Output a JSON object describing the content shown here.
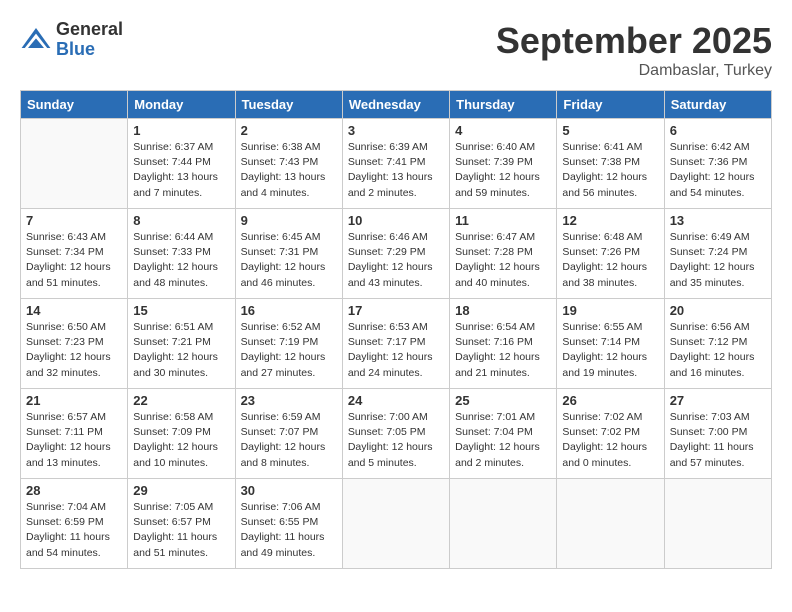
{
  "header": {
    "logo_general": "General",
    "logo_blue": "Blue",
    "month_title": "September 2025",
    "location": "Dambaslar, Turkey"
  },
  "days_of_week": [
    "Sunday",
    "Monday",
    "Tuesday",
    "Wednesday",
    "Thursday",
    "Friday",
    "Saturday"
  ],
  "weeks": [
    [
      {
        "day": "",
        "sunrise": "",
        "sunset": "",
        "daylight": ""
      },
      {
        "day": "1",
        "sunrise": "6:37 AM",
        "sunset": "7:44 PM",
        "daylight": "13 hours and 7 minutes."
      },
      {
        "day": "2",
        "sunrise": "6:38 AM",
        "sunset": "7:43 PM",
        "daylight": "13 hours and 4 minutes."
      },
      {
        "day": "3",
        "sunrise": "6:39 AM",
        "sunset": "7:41 PM",
        "daylight": "13 hours and 2 minutes."
      },
      {
        "day": "4",
        "sunrise": "6:40 AM",
        "sunset": "7:39 PM",
        "daylight": "12 hours and 59 minutes."
      },
      {
        "day": "5",
        "sunrise": "6:41 AM",
        "sunset": "7:38 PM",
        "daylight": "12 hours and 56 minutes."
      },
      {
        "day": "6",
        "sunrise": "6:42 AM",
        "sunset": "7:36 PM",
        "daylight": "12 hours and 54 minutes."
      }
    ],
    [
      {
        "day": "7",
        "sunrise": "6:43 AM",
        "sunset": "7:34 PM",
        "daylight": "12 hours and 51 minutes."
      },
      {
        "day": "8",
        "sunrise": "6:44 AM",
        "sunset": "7:33 PM",
        "daylight": "12 hours and 48 minutes."
      },
      {
        "day": "9",
        "sunrise": "6:45 AM",
        "sunset": "7:31 PM",
        "daylight": "12 hours and 46 minutes."
      },
      {
        "day": "10",
        "sunrise": "6:46 AM",
        "sunset": "7:29 PM",
        "daylight": "12 hours and 43 minutes."
      },
      {
        "day": "11",
        "sunrise": "6:47 AM",
        "sunset": "7:28 PM",
        "daylight": "12 hours and 40 minutes."
      },
      {
        "day": "12",
        "sunrise": "6:48 AM",
        "sunset": "7:26 PM",
        "daylight": "12 hours and 38 minutes."
      },
      {
        "day": "13",
        "sunrise": "6:49 AM",
        "sunset": "7:24 PM",
        "daylight": "12 hours and 35 minutes."
      }
    ],
    [
      {
        "day": "14",
        "sunrise": "6:50 AM",
        "sunset": "7:23 PM",
        "daylight": "12 hours and 32 minutes."
      },
      {
        "day": "15",
        "sunrise": "6:51 AM",
        "sunset": "7:21 PM",
        "daylight": "12 hours and 30 minutes."
      },
      {
        "day": "16",
        "sunrise": "6:52 AM",
        "sunset": "7:19 PM",
        "daylight": "12 hours and 27 minutes."
      },
      {
        "day": "17",
        "sunrise": "6:53 AM",
        "sunset": "7:17 PM",
        "daylight": "12 hours and 24 minutes."
      },
      {
        "day": "18",
        "sunrise": "6:54 AM",
        "sunset": "7:16 PM",
        "daylight": "12 hours and 21 minutes."
      },
      {
        "day": "19",
        "sunrise": "6:55 AM",
        "sunset": "7:14 PM",
        "daylight": "12 hours and 19 minutes."
      },
      {
        "day": "20",
        "sunrise": "6:56 AM",
        "sunset": "7:12 PM",
        "daylight": "12 hours and 16 minutes."
      }
    ],
    [
      {
        "day": "21",
        "sunrise": "6:57 AM",
        "sunset": "7:11 PM",
        "daylight": "12 hours and 13 minutes."
      },
      {
        "day": "22",
        "sunrise": "6:58 AM",
        "sunset": "7:09 PM",
        "daylight": "12 hours and 10 minutes."
      },
      {
        "day": "23",
        "sunrise": "6:59 AM",
        "sunset": "7:07 PM",
        "daylight": "12 hours and 8 minutes."
      },
      {
        "day": "24",
        "sunrise": "7:00 AM",
        "sunset": "7:05 PM",
        "daylight": "12 hours and 5 minutes."
      },
      {
        "day": "25",
        "sunrise": "7:01 AM",
        "sunset": "7:04 PM",
        "daylight": "12 hours and 2 minutes."
      },
      {
        "day": "26",
        "sunrise": "7:02 AM",
        "sunset": "7:02 PM",
        "daylight": "12 hours and 0 minutes."
      },
      {
        "day": "27",
        "sunrise": "7:03 AM",
        "sunset": "7:00 PM",
        "daylight": "11 hours and 57 minutes."
      }
    ],
    [
      {
        "day": "28",
        "sunrise": "7:04 AM",
        "sunset": "6:59 PM",
        "daylight": "11 hours and 54 minutes."
      },
      {
        "day": "29",
        "sunrise": "7:05 AM",
        "sunset": "6:57 PM",
        "daylight": "11 hours and 51 minutes."
      },
      {
        "day": "30",
        "sunrise": "7:06 AM",
        "sunset": "6:55 PM",
        "daylight": "11 hours and 49 minutes."
      },
      {
        "day": "",
        "sunrise": "",
        "sunset": "",
        "daylight": ""
      },
      {
        "day": "",
        "sunrise": "",
        "sunset": "",
        "daylight": ""
      },
      {
        "day": "",
        "sunrise": "",
        "sunset": "",
        "daylight": ""
      },
      {
        "day": "",
        "sunrise": "",
        "sunset": "",
        "daylight": ""
      }
    ]
  ]
}
